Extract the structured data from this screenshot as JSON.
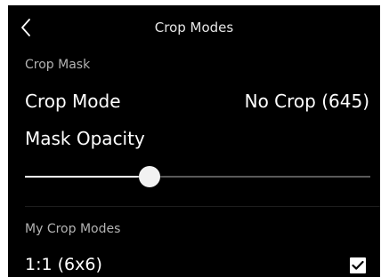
{
  "nav": {
    "title": "Crop Modes",
    "back_icon": "chevron-left-icon"
  },
  "crop_mask": {
    "header": "Crop Mask",
    "crop_mode_label": "Crop Mode",
    "crop_mode_value": "No Crop (645)",
    "mask_opacity_label": "Mask Opacity",
    "mask_opacity_level": 0.36
  },
  "my_crop_modes": {
    "header": "My Crop Modes",
    "items": [
      {
        "label": "1:1 (6x6)",
        "checked": true,
        "check_icon": "checkmark-icon"
      }
    ]
  },
  "colors": {
    "background": "#000000",
    "text": "#ffffff",
    "secondary_text": "#b3b3b3",
    "slider_fill": "#ffffff",
    "slider_track": "#5a5a5a"
  }
}
